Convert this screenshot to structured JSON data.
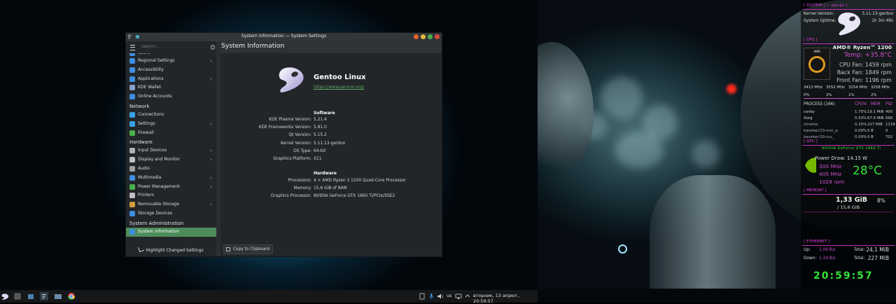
{
  "window": {
    "title": "System Information — System Settings"
  },
  "sidebar": {
    "search_placeholder": "Search...",
    "partial_item": "Users",
    "groups": [
      {
        "items": [
          {
            "label": "Regional Settings",
            "chevron": true,
            "color": "#3d8ee0"
          },
          {
            "label": "Accessibility",
            "chevron": false,
            "color": "#3d8ee0"
          },
          {
            "label": "Applications",
            "chevron": true,
            "color": "#3d8ee0"
          },
          {
            "label": "KDE Wallet",
            "chevron": false,
            "color": "#8aa0c8"
          },
          {
            "label": "Online Accounts",
            "chevron": false,
            "color": "#3d8ee0"
          }
        ]
      },
      {
        "category": "Network",
        "items": [
          {
            "label": "Connections",
            "chevron": false,
            "color": "#38a0e8"
          },
          {
            "label": "Settings",
            "chevron": true,
            "color": "#38a0e8"
          },
          {
            "label": "Firewall",
            "chevron": false,
            "color": "#4ab04a"
          }
        ]
      },
      {
        "category": "Hardware",
        "items": [
          {
            "label": "Input Devices",
            "chevron": true,
            "color": "#b0b0b0"
          },
          {
            "label": "Display and Monitor",
            "chevron": true,
            "color": "#c0c0c0"
          },
          {
            "label": "Audio",
            "chevron": false,
            "color": "#a0a0a0"
          },
          {
            "label": "Multimedia",
            "chevron": true,
            "color": "#3d8ee0"
          },
          {
            "label": "Power Management",
            "chevron": true,
            "color": "#4ab04a"
          },
          {
            "label": "Printers",
            "chevron": false,
            "color": "#c0c0c0"
          },
          {
            "label": "Removable Storage",
            "chevron": true,
            "color": "#d0a040"
          },
          {
            "label": "Storage Devices",
            "chevron": false,
            "color": "#3d8ee0"
          }
        ]
      },
      {
        "category": "System Administration",
        "items": [
          {
            "label": "System Information",
            "chevron": false,
            "color": "#3d8ee0",
            "selected": true
          }
        ]
      }
    ],
    "footer_label": "Highlight Changed Settings"
  },
  "main": {
    "title": "System Information",
    "distro_name": "Gentoo Linux",
    "distro_url": "https://www.gentoo.org/",
    "software_header": "Software",
    "software": [
      {
        "key": "KDE Plasma Version:",
        "value": "5.21.4"
      },
      {
        "key": "KDE Frameworks Version:",
        "value": "5.81.0"
      },
      {
        "key": "Qt Version:",
        "value": "5.15.2"
      },
      {
        "key": "Kernel Version:",
        "value": "5.11.13-gentoo"
      },
      {
        "key": "OS Type:",
        "value": "64-bit"
      },
      {
        "key": "Graphics Platform:",
        "value": "X11"
      }
    ],
    "hardware_header": "Hardware",
    "hardware": [
      {
        "key": "Processors:",
        "value": "4 × AMD Ryzen 3 1200 Quad-Core Processor"
      },
      {
        "key": "Memory:",
        "value": "15,6 GiB of RAM"
      },
      {
        "key": "Graphics Processor:",
        "value": "NVIDIA GeForce GTX 1660 Ti/PCIe/SSE2"
      }
    ],
    "copy_button": "Copy to Clipboard"
  },
  "taskbar": {
    "language": "us",
    "clock": "вторник, 13 апрел , 20:59:57"
  },
  "conky": {
    "system_header": "[ SYSTEM ] — vpv-pc ]",
    "kernel_label": "Kernel Version:",
    "kernel_value": "5.11.13-gentoo",
    "uptime_label": "System Uptime:",
    "uptime_value": "1h 3m 49s",
    "cpu_header": "[ CPU ]",
    "cpu_name": "AMD® Ryzen™ 1200",
    "cpu_temp": "Temp: +35.8°C",
    "cpu_fan": "CPU Fan: 1459 rpm",
    "back_fan": "Back Fan: 1849 rpm",
    "front_fan": "Front Fan: 1196 rpm",
    "freqs": [
      "3413 MHz",
      "3552 MHz",
      "3254 MHz",
      "3258 MHz"
    ],
    "loads": [
      "0%",
      "2%",
      "1%",
      "2%"
    ],
    "process_header": {
      "title": "PROCESS (166)",
      "cpu": "CPU%",
      "mem": "MEM",
      "pid": "PID"
    },
    "processes": [
      {
        "name": "conky",
        "cpu": "1.75%",
        "mem": "19.1 MiB",
        "pid": "400"
      },
      {
        "name": "Xorg",
        "cpu": "0.50%",
        "mem": "67.6 MiB",
        "pid": "666"
      },
      {
        "name": "chrome",
        "cpu": "0.25%",
        "mem": "227 MiB",
        "pid": "1118"
      },
      {
        "name": "kworker/13-mm_p",
        "cpu": "0.00%",
        "mem": "0 B",
        "pid": "0"
      },
      {
        "name": "kworker/10-rcu_",
        "cpu": "0.00%",
        "mem": "0 B",
        "pid": "702"
      }
    ],
    "gpu_header": "[ GPU ]",
    "gpu_name": "NVIDIA GeForce GTX 1660 Ti",
    "gpu_power": "Power Draw: 14.15 W",
    "gpu_clock": "300 MHz",
    "mem_clock": "405 MHz",
    "gpu_fan": "1028 rpm",
    "gpu_temp": "28°C",
    "memory_header": "[ MEMORY ]",
    "mem_used": "1,33 GiB",
    "mem_total": "/ 15,6 GiB",
    "mem_pct": "8%",
    "ethernet_header": "[ ETHERNET ]",
    "up_label": "Up:",
    "up_value": "1.09 B/s",
    "down_label": "Down:",
    "down_value": "1.19 B/s",
    "total_up_label": "Total:",
    "total_up": "24,1 MiB",
    "total_down_label": "Total:",
    "total_down": "227 MiB",
    "clock": "20:59:57"
  }
}
